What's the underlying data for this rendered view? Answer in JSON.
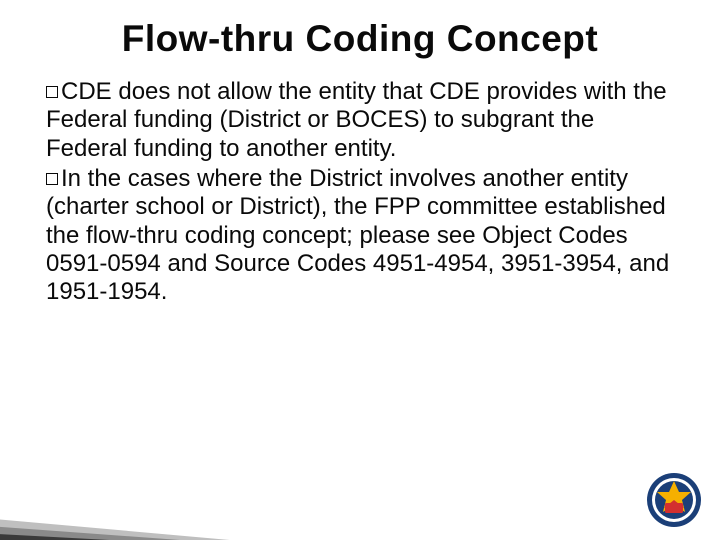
{
  "title": "Flow-thru Coding Concept",
  "bullets": [
    {
      "text": "CDE does not allow the entity that CDE provides with the Federal funding (District or BOCES) to subgrant the Federal funding to another entity."
    },
    {
      "text": "In the cases where the District involves another entity (charter school or District), the FPP committee established the flow-thru coding concept; please see Object Codes 0591-0594 and Source Codes 4951-4954, 3951-3954, and 1951-1954."
    }
  ],
  "logo_name": "metro-logo"
}
